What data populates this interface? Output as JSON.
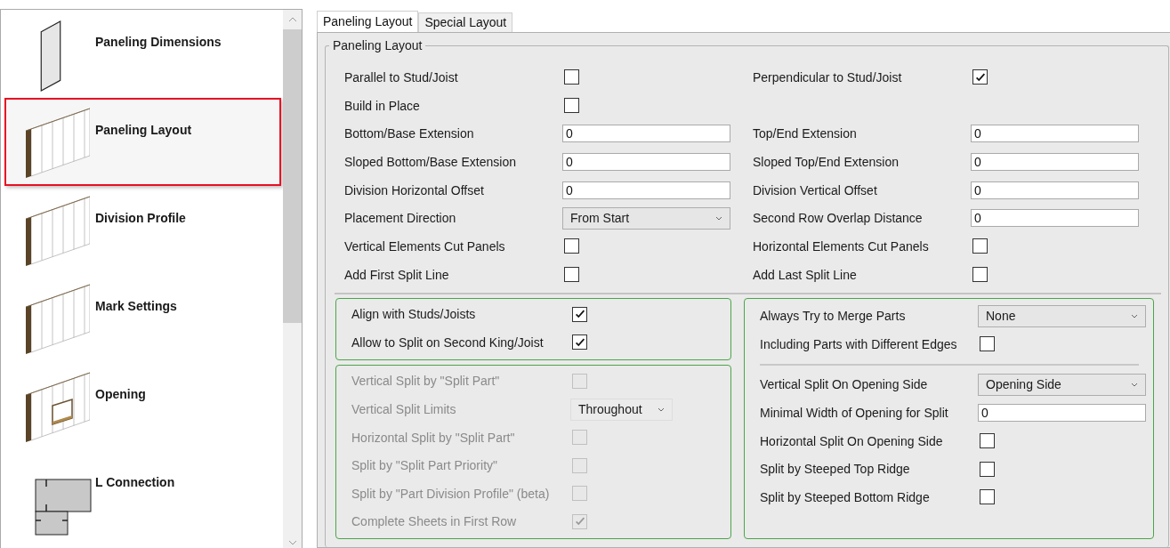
{
  "sidebar": {
    "items": [
      {
        "label": "Paneling Dimensions",
        "kind": "panel",
        "selected": false
      },
      {
        "label": "Paneling Layout",
        "kind": "wall",
        "selected": true
      },
      {
        "label": "Division Profile",
        "kind": "wall",
        "selected": false
      },
      {
        "label": "Mark Settings",
        "kind": "wall",
        "selected": false
      },
      {
        "label": "Opening",
        "kind": "wall-opening",
        "selected": false
      },
      {
        "label": "L Connection",
        "kind": "l-connection",
        "selected": false
      }
    ]
  },
  "tabs": [
    {
      "label": "Paneling Layout",
      "selected": true
    },
    {
      "label": "Special Layout",
      "selected": false
    }
  ],
  "group": {
    "title": "Paneling Layout",
    "rows": [
      {
        "left": {
          "label": "Parallel to Stud/Joist",
          "kind": "checkbox",
          "checked": false
        },
        "right": {
          "label": "Perpendicular to Stud/Joist",
          "kind": "checkbox",
          "checked": true
        }
      },
      {
        "left": {
          "label": "Build in Place",
          "kind": "checkbox",
          "checked": false
        }
      },
      {
        "left": {
          "label": "Bottom/Base Extension",
          "kind": "text",
          "value": "0"
        },
        "right": {
          "label": "Top/End Extension",
          "kind": "text",
          "value": "0"
        }
      },
      {
        "left": {
          "label": "Sloped Bottom/Base Extension",
          "kind": "text",
          "value": "0"
        },
        "right": {
          "label": "Sloped Top/End Extension",
          "kind": "text",
          "value": "0"
        }
      },
      {
        "left": {
          "label": "Division Horizontal Offset",
          "kind": "text",
          "value": "0"
        },
        "right": {
          "label": "Division Vertical Offset",
          "kind": "text",
          "value": "0"
        }
      },
      {
        "left": {
          "label": "Placement Direction",
          "kind": "dropdown",
          "value": "From Start"
        },
        "right": {
          "label": "Second Row Overlap Distance",
          "kind": "text",
          "value": "0"
        }
      },
      {
        "left": {
          "label": "Vertical Elements Cut Panels",
          "kind": "checkbox",
          "checked": false
        },
        "right": {
          "label": "Horizontal Elements Cut Panels",
          "kind": "checkbox",
          "checked": false
        }
      },
      {
        "left": {
          "label": "Add First Split Line",
          "kind": "checkbox",
          "checked": false
        },
        "right": {
          "label": "Add Last Split Line",
          "kind": "checkbox",
          "checked": false
        }
      }
    ]
  },
  "left_groups": [
    {
      "disabled": false,
      "items": [
        {
          "label": "Align with Studs/Joists",
          "kind": "checkbox",
          "checked": true
        },
        {
          "label": "Allow to Split on Second King/Joist",
          "kind": "checkbox",
          "checked": true
        }
      ]
    },
    {
      "disabled": true,
      "items": [
        {
          "label": "Vertical Split by \"Split Part\"",
          "kind": "checkbox",
          "checked": false
        },
        {
          "label": "Vertical Split Limits",
          "kind": "dropdown",
          "value": "Throughout"
        },
        {
          "label": "Horizontal Split by \"Split Part\"",
          "kind": "checkbox",
          "checked": false
        },
        {
          "label": "Split by \"Split Part Priority\"",
          "kind": "checkbox",
          "checked": false
        },
        {
          "label": "Split by \"Part Division Profile\" (beta)",
          "kind": "checkbox",
          "checked": false
        },
        {
          "label": "Complete Sheets in First Row",
          "kind": "checkbox",
          "checked": true
        }
      ]
    }
  ],
  "right_group": {
    "items": [
      {
        "label": "Always Try to Merge Parts",
        "kind": "dropdown",
        "value": "None"
      },
      {
        "label": "Including Parts with Different Edges",
        "kind": "checkbox",
        "checked": false
      },
      {
        "kind": "separator"
      },
      {
        "label": "Vertical Split On Opening Side",
        "kind": "dropdown",
        "value": "Opening Side"
      },
      {
        "label": "Minimal Width of Opening for Split",
        "kind": "text",
        "value": "0"
      },
      {
        "label": "Horizontal Split On Opening Side",
        "kind": "checkbox",
        "checked": false
      },
      {
        "label": "Split by Steeped Top Ridge",
        "kind": "checkbox",
        "checked": false
      },
      {
        "label": "Split by Steeped Bottom Ridge",
        "kind": "checkbox",
        "checked": false
      }
    ]
  }
}
